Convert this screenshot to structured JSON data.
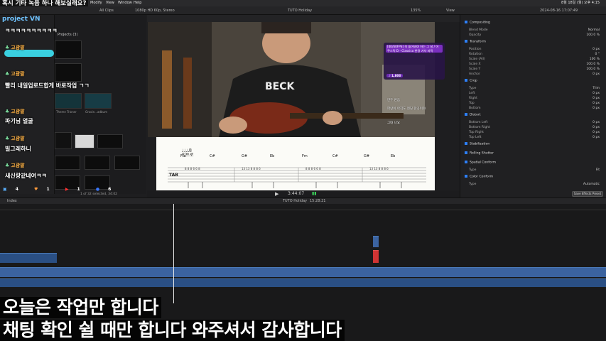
{
  "menubar": {
    "app": "Modify",
    "items": [
      "View",
      "Window",
      "Help"
    ],
    "clock": "8월 18일 (월) 오후 4:15"
  },
  "top_banner": "혹시 기타 녹음 하나 해보실래요?",
  "toolbar": {
    "all_clips": "All Clips",
    "viewer_format": "1080p HD 60p, Stereo",
    "project_name": "TUTO Holiday",
    "zoom": "135%",
    "view": "View",
    "inspector_date": "2024-08-16 17:07:49"
  },
  "browser": {
    "projects_label": "Projects",
    "projects_count": "(3)",
    "items": [
      {
        "label": "Theme Trioner"
      },
      {
        "label": "Grooin...adbum"
      },
      {
        "label": "JT2... 녹음"
      },
      {
        "label": "녹음1"
      }
    ],
    "status": "1 of 32 selected, 34:02"
  },
  "chat": {
    "channel": "project VN",
    "messages": [
      {
        "user": "",
        "text": "ㅋㅋㅋㅋㅋㅋㅋㅋㅋㅋ"
      },
      {
        "user": "고광팔",
        "text": ""
      },
      {
        "user": "고광팔",
        "text": "빨리 내일업로드합게 바로작업 ㄱㄱ"
      },
      {
        "user": "고광팔",
        "text": "파기님 얼굴"
      },
      {
        "user": "고광팔",
        "text": "빌그레하니"
      },
      {
        "user": "고광팔",
        "text": "새신랑같네여ㅋㅋ"
      }
    ],
    "stats": {
      "viewers": "4",
      "likes": "1",
      "youtube": "1",
      "other": "6"
    }
  },
  "viewer": {
    "timecode": "3:44:07",
    "donation": {
      "title": "[4K/60FPS] 꼭 들어봐야 하는 그 날 / 어쿠스틱 D - Classico 한글 가사 자막",
      "amount": "1,800"
    },
    "video_chat": [
      "만두 반음",
      "그대 나요",
      "파랑이 아직도 엔딩 한곡이야"
    ],
    "sheet": {
      "header": "인트로",
      "chords": [
        "Fm",
        "C#",
        "G#",
        "Eb",
        "Fm",
        "C#",
        "G#",
        "Eb"
      ]
    }
  },
  "inspector": {
    "sections": [
      {
        "name": "Compositing",
        "rows": [
          {
            "label": "Blend Mode",
            "value": "Normal"
          },
          {
            "label": "Opacity",
            "value": "100.0 %"
          }
        ]
      },
      {
        "name": "Transform",
        "rows": [
          {
            "label": "Position",
            "value": "0 px"
          },
          {
            "label": "Rotation",
            "value": "0 °"
          },
          {
            "label": "Scale (All)",
            "value": "100 %"
          },
          {
            "label": "Scale X",
            "value": "100.0 %"
          },
          {
            "label": "Scale Y",
            "value": "100.0 %"
          },
          {
            "label": "Anchor",
            "value": "0 px"
          }
        ]
      },
      {
        "name": "Crop",
        "rows": [
          {
            "label": "Type",
            "value": "Trim"
          },
          {
            "label": "Left",
            "value": "0 px"
          },
          {
            "label": "Right",
            "value": "0 px"
          },
          {
            "label": "Top",
            "value": "0 px"
          },
          {
            "label": "Bottom",
            "value": "0 px"
          }
        ]
      },
      {
        "name": "Distort",
        "rows": [
          {
            "label": "Bottom Left",
            "value": "0 px"
          },
          {
            "label": "Bottom Right",
            "value": "0 px"
          },
          {
            "label": "Top Right",
            "value": "0 px"
          },
          {
            "label": "Top Left",
            "value": "0 px"
          }
        ]
      },
      {
        "name": "Stabilization",
        "rows": []
      },
      {
        "name": "Rolling Shutter",
        "rows": []
      },
      {
        "name": "Spatial Conform",
        "rows": [
          {
            "label": "Type",
            "value": "Fit"
          }
        ]
      },
      {
        "name": "Color Conform",
        "rows": [
          {
            "label": "Type",
            "value": "Automatic"
          }
        ]
      }
    ],
    "save_button": "Save Effects Preset"
  },
  "timeline": {
    "index_label": "Index",
    "project": "TUTO Holiday",
    "duration": "15:28:21"
  },
  "subtitles": [
    "오늘은 작업만 합니다",
    "채팅 확인 쉴 때만 합니다 와주셔서 감사합니다"
  ]
}
